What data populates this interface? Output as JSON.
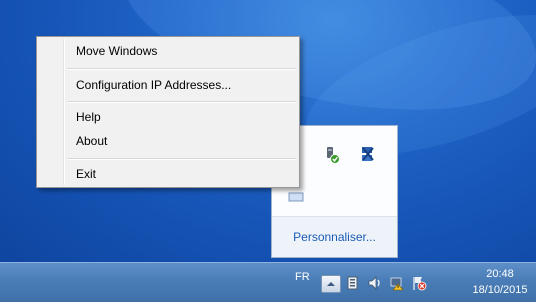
{
  "context_menu": {
    "items": [
      {
        "label": "Move Windows"
      },
      {
        "label": "Configuration IP Addresses..."
      },
      {
        "label": "Help"
      },
      {
        "label": "About"
      },
      {
        "label": "Exit"
      }
    ]
  },
  "notification_overflow": {
    "customize_label": "Personnaliser..."
  },
  "taskbar": {
    "language": "FR",
    "time": "20:48",
    "date": "18/10/2015"
  },
  "icons": {
    "tray": [
      "show-hidden-icons",
      "usb-device-icon",
      "network-icon",
      "action-center-flag-icon",
      "speaker-icon",
      "flag-error-icon"
    ]
  },
  "colors": {
    "desktop": "#1f63c6",
    "taskbar": "#4a7db7",
    "link": "#1a5bb5"
  }
}
